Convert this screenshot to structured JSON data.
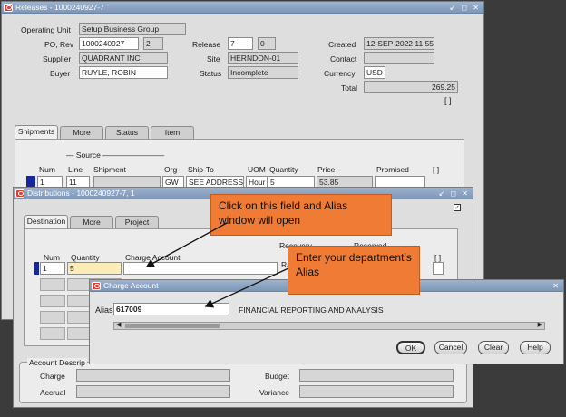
{
  "releases": {
    "title": "Releases - 1000240927-7",
    "controls": "↙ ◻ ✕",
    "operating_unit_label": "Operating Unit",
    "operating_unit": "Setup Business Group",
    "po_rev_label": "PO, Rev",
    "po": "1000240927",
    "rev": "2",
    "release_label": "Release",
    "release": "7",
    "release_rev": "0",
    "created_label": "Created",
    "created": "12-SEP-2022 11:55",
    "supplier_label": "Supplier",
    "supplier": "QUADRANT INC",
    "site_label": "Site",
    "site": "HERNDON-01",
    "contact_label": "Contact",
    "contact": "",
    "buyer_label": "Buyer",
    "buyer": "RUYLE, ROBIN",
    "status_label": "Status",
    "status": "Incomplete",
    "currency_label": "Currency",
    "currency": "USD",
    "total_label": "Total",
    "total": "269.25",
    "bracket": "[ ]",
    "tabs": [
      "Shipments",
      "More",
      "Status",
      "Item"
    ],
    "source_label": "Source",
    "columns": [
      "Num",
      "Line",
      "Shipment",
      "Org",
      "Ship-To",
      "UOM",
      "Quantity",
      "Price",
      "Promised"
    ],
    "row": {
      "num": "1",
      "line": "11",
      "shipment": "",
      "org": "GW",
      "ship_to": "SEE ADDRESS",
      "uom": "Hour",
      "quantity": "5",
      "price": "53.85",
      "promised": ""
    }
  },
  "distributions": {
    "title": "Distributions - 1000240927-7, 1",
    "controls": "↙ ◻ ✕",
    "tabs": [
      "Destination",
      "More",
      "Project"
    ],
    "columns": {
      "num": "Num",
      "quantity": "Quantity",
      "charge_account": "Charge Account",
      "recovery": "Recovery",
      "recovery2": "Ra",
      "reserved": "Reserved"
    },
    "row": {
      "num": "1",
      "quantity": "5",
      "charge_account": ""
    },
    "bracket": "[ ]",
    "account_desc_label": "Account Descrip",
    "charge_label": "Charge",
    "accrual_label": "Accrual",
    "budget_label": "Budget",
    "variance_label": "Variance"
  },
  "charge_account": {
    "title": "Charge Account",
    "controls": "✕",
    "alias_label": "Alias",
    "alias": "617009",
    "description": "FINANCIAL REPORTING AND ANALYSIS",
    "buttons": {
      "ok": "OK",
      "cancel": "Cancel",
      "clear": "Clear",
      "help": "Help"
    }
  },
  "callouts": {
    "first": "Click on this field and Alias window will open",
    "second": "Enter your department’s Alias"
  },
  "colors": {
    "callout": "#ef7b34",
    "titlebar": "#8aa3c3",
    "required": "#fbecb8"
  }
}
